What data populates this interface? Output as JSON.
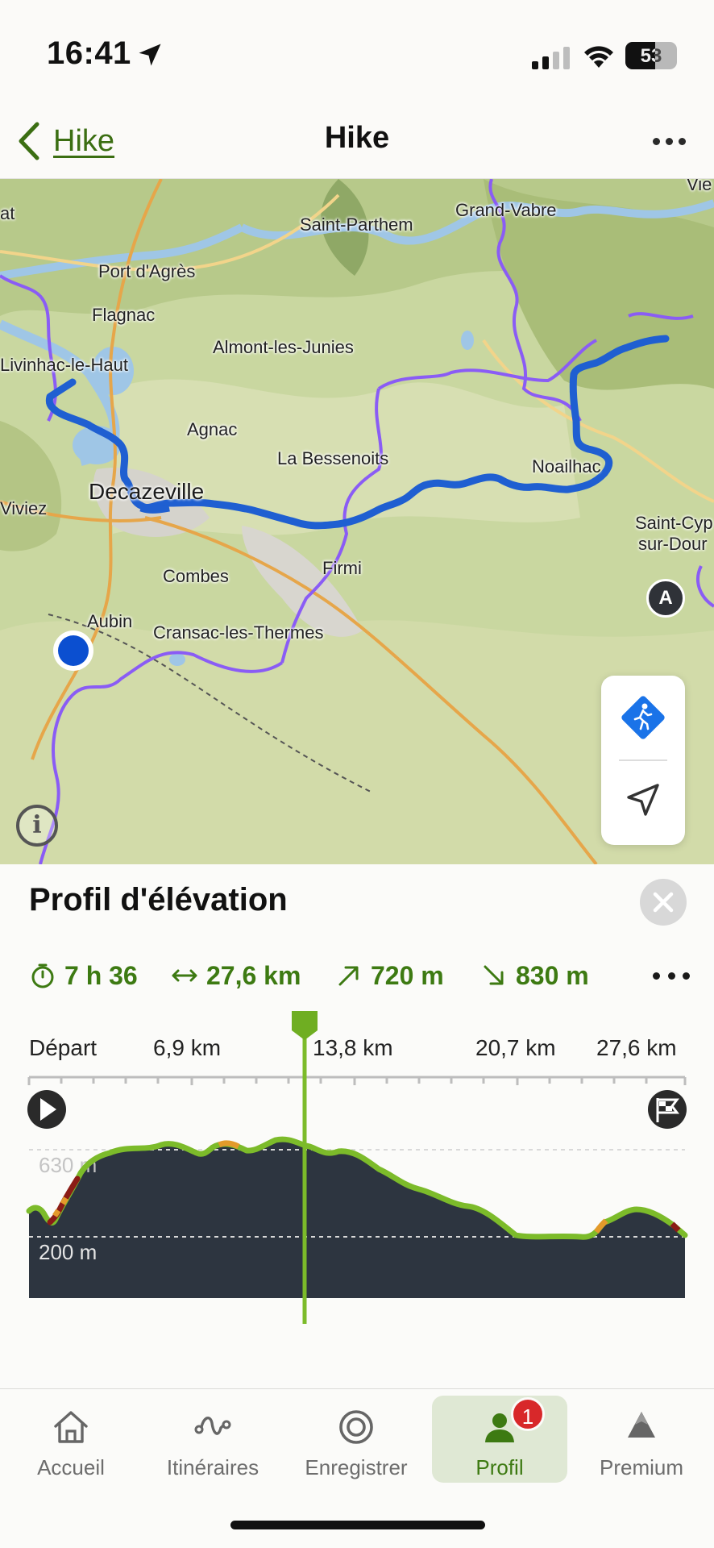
{
  "status_bar": {
    "time": "16:41",
    "battery": "53"
  },
  "nav": {
    "back_label": "Hike",
    "title": "Hike"
  },
  "map": {
    "places": [
      {
        "name": "Saint-Parthem"
      },
      {
        "name": "Grand-Vabre"
      },
      {
        "name": "Port d'Agrès"
      },
      {
        "name": "Flagnac"
      },
      {
        "name": "Almont-les-Junies"
      },
      {
        "name": "Livinhac-le-Haut"
      },
      {
        "name": "Agnac"
      },
      {
        "name": "La Bessenoits"
      },
      {
        "name": "Noailhac"
      },
      {
        "name": "Decazeville"
      },
      {
        "name": "Viviez"
      },
      {
        "name": "Saint-Cyp"
      },
      {
        "name": "sur-Dour"
      },
      {
        "name": "Firmi"
      },
      {
        "name": "Combes"
      },
      {
        "name": "Aubin"
      },
      {
        "name": "Cransac-les-Thermes"
      },
      {
        "name": "at"
      },
      {
        "name": "Vie"
      }
    ],
    "route_start_marker": "A",
    "info_label": "i"
  },
  "elevation": {
    "title": "Profil d'élévation",
    "stats": {
      "duration": "7 h 36",
      "distance": "27,6 km",
      "ascent": "720 m",
      "descent": "830 m"
    },
    "axis": [
      "Départ",
      "6,9 km",
      "13,8 km",
      "20,7 km",
      "27,6 km"
    ],
    "grid_labels": [
      "630 m",
      "200 m"
    ],
    "cursor_position_km": 13.8,
    "colors": {
      "fill": "#2d3540",
      "line": "#7cbb2a",
      "steep": "#e39a2b",
      "very_steep": "#8b1c16",
      "accent": "#3d7a12"
    }
  },
  "tabs": [
    {
      "label": "Accueil",
      "icon": "home-icon",
      "active": false
    },
    {
      "label": "Itinéraires",
      "icon": "routes-icon",
      "active": false
    },
    {
      "label": "Enregistrer",
      "icon": "record-icon",
      "active": false
    },
    {
      "label": "Profil",
      "icon": "profile-icon",
      "active": true,
      "badge": "1"
    },
    {
      "label": "Premium",
      "icon": "premium-icon",
      "active": false
    }
  ]
}
